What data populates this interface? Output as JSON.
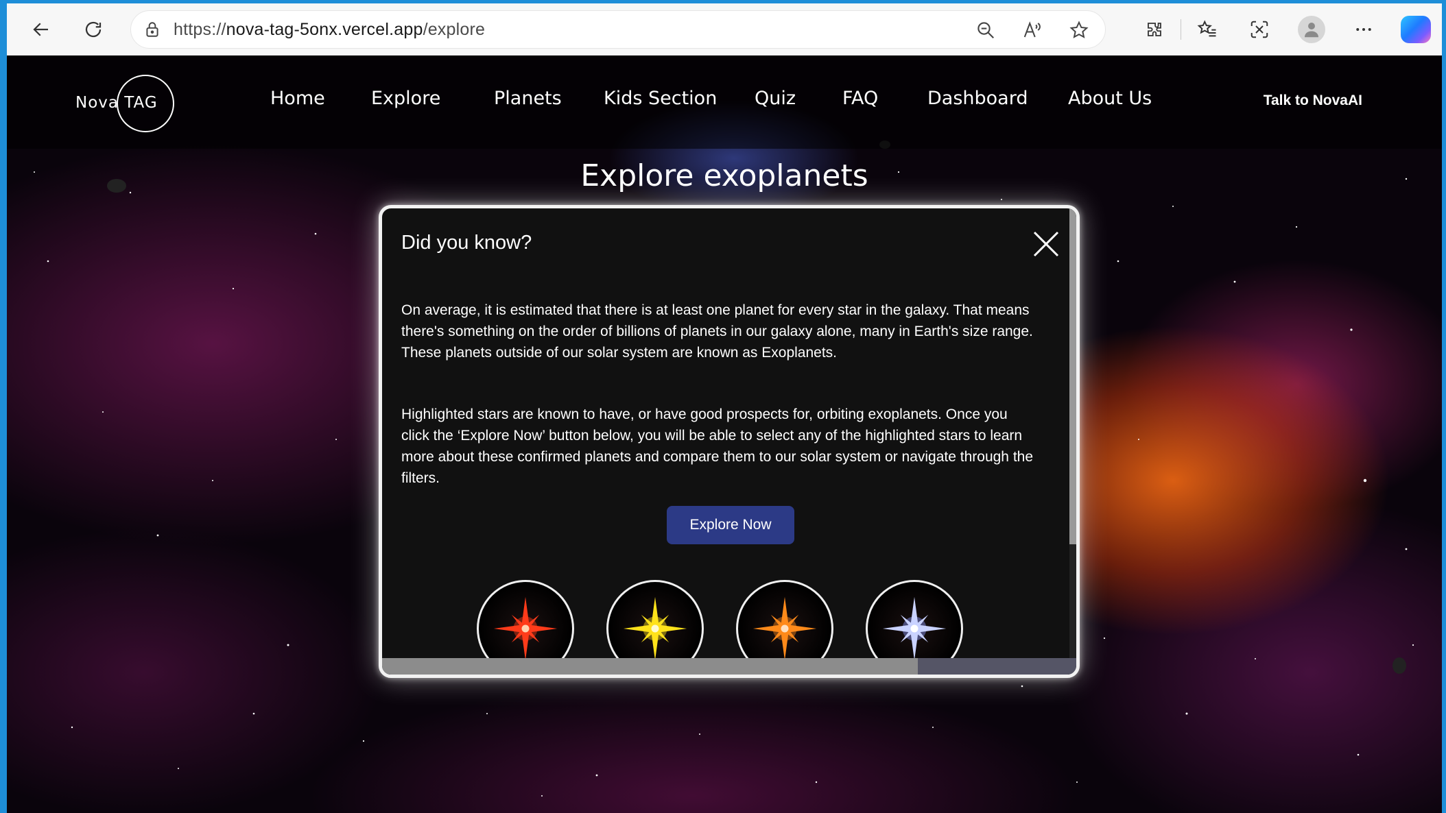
{
  "browser": {
    "url_prefix": "https://",
    "url_host": "nova-tag-5onx.vercel.app",
    "url_path": "/explore"
  },
  "site": {
    "logo_text": "Nova TAG",
    "nav": [
      "Home",
      "Explore",
      "Planets",
      "Kids Section",
      "Quiz",
      "FAQ",
      "Dashboard",
      "About Us"
    ],
    "talk_label": "Talk to NovaAI",
    "page_title": "Explore exoplanets"
  },
  "modal": {
    "title": "Did you know?",
    "paragraph1": "On average, it is estimated that there is at least one planet for every star in the galaxy. That means there's something on the order of billions of planets in our galaxy alone, many in Earth's size range. These planets outside of our solar system are known as Exoplanets.",
    "paragraph2": "Highlighted stars are known to have, or have good prospects for, orbiting exoplanets. Once you click the ‘Explore Now’ button below, you will be able to select any of the highlighted stars to learn more about these confirmed planets and compare them to our solar system or navigate through the filters.",
    "button_label": "Explore Now",
    "stars": [
      {
        "icon": "red-star-icon",
        "color": "#ff3b1a"
      },
      {
        "icon": "yellow-star-icon",
        "color": "#ffe21a"
      },
      {
        "icon": "orange-star-icon",
        "color": "#ff8a1a"
      },
      {
        "icon": "white-blue-star-icon",
        "color": "#c9d2ff"
      }
    ]
  },
  "colors": {
    "frame": "#1e8ed8",
    "button": "#2c3a86",
    "modal_bg": "#111111"
  }
}
